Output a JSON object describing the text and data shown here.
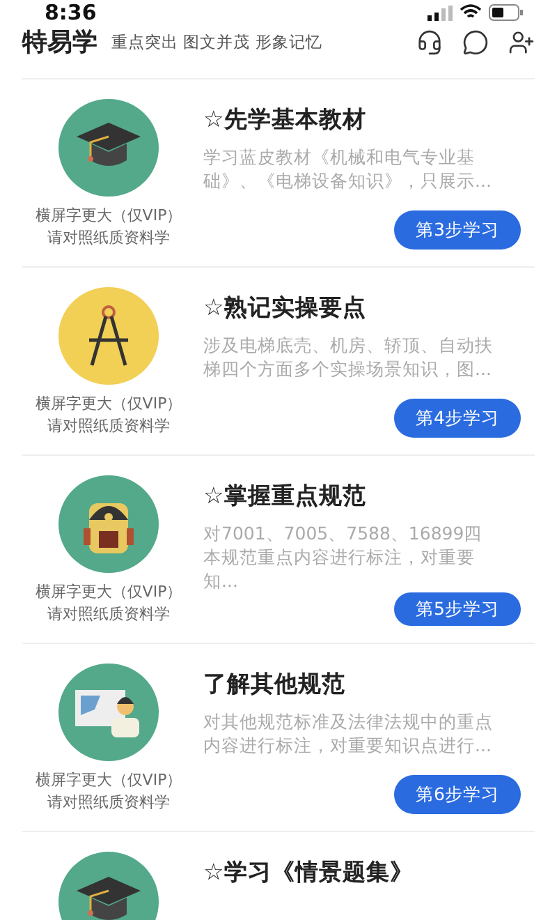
{
  "status_bar": {
    "time": "8:36"
  },
  "header": {
    "title": "特易学",
    "slogan": "重点突出 图文并茂 形象记忆"
  },
  "lessons": [
    {
      "kind": "cap",
      "title": "☆先学基本教材",
      "description": "学习蓝皮教材《机械和电气专业基础》、《电梯设备知识》，只展示...",
      "caption_1": "横屏字更大（仅VIP）",
      "caption_2": "请对照纸质资料学",
      "button": "第3步学习"
    },
    {
      "kind": "compass",
      "title": "☆熟记实操要点",
      "description": "涉及电梯底壳、机房、轿顶、自动扶梯四个方面多个实操场景知识，图...",
      "caption_1": "横屏字更大（仅VIP）",
      "caption_2": "请对照纸质资料学",
      "button": "第4步学习"
    },
    {
      "kind": "backpack",
      "title": "☆掌握重点规范",
      "description": "对7001、7005、7588、16899四本规范重点内容进行标注，对重要知...",
      "caption_1": "横屏字更大（仅VIP）",
      "caption_2": "请对照纸质资料学",
      "button": "第5步学习"
    },
    {
      "kind": "teacher",
      "title": "了解其他规范",
      "description": "对其他规范标准及法律法规中的重点内容进行标注，对重要知识点进行...",
      "caption_1": "横屏字更大（仅VIP）",
      "caption_2": "请对照纸质资料学",
      "button": "第6步学习"
    },
    {
      "kind": "cap",
      "title": "☆学习《情景题集》"
    }
  ]
}
